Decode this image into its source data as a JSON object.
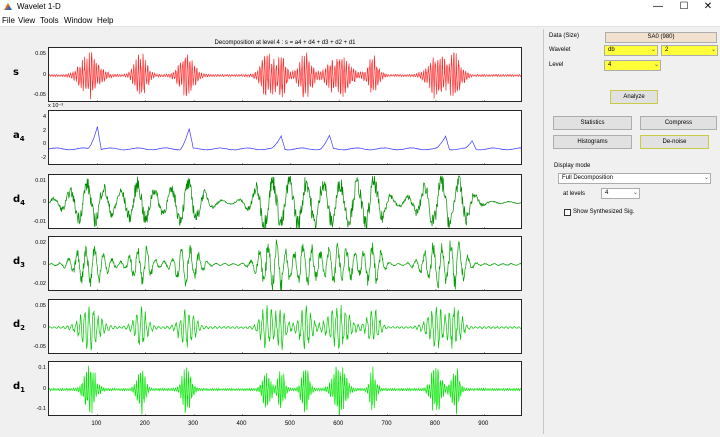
{
  "window": {
    "title": "Wavelet 1-D",
    "minimize": "—",
    "maximize": "☐",
    "close": "✕"
  },
  "menu": [
    "File",
    "View",
    "Tools",
    "Window",
    "Help"
  ],
  "figure": {
    "title": "Decomposition at level 4 : s = a4 + d4 + d3 + d2 + d1",
    "rows": [
      {
        "label": "s",
        "sub": "",
        "ticks": [
          "0.05",
          "0",
          "-0.05"
        ],
        "exponent": "",
        "color": "#ff2a2a"
      },
      {
        "label": "a",
        "sub": "4",
        "ticks": [
          "4",
          "2",
          "0",
          "-2"
        ],
        "exponent": "x 10⁻³",
        "color": "#3a3aff"
      },
      {
        "label": "d",
        "sub": "4",
        "ticks": [
          "0.01",
          "0",
          "-0.01"
        ],
        "exponent": "",
        "color": "#008c00"
      },
      {
        "label": "d",
        "sub": "3",
        "ticks": [
          "0.02",
          "0",
          "-0.02"
        ],
        "exponent": "",
        "color": "#00a000"
      },
      {
        "label": "d",
        "sub": "2",
        "ticks": [
          "0.05",
          "0",
          "-0.05"
        ],
        "exponent": "",
        "color": "#00c800"
      },
      {
        "label": "d",
        "sub": "1",
        "ticks": [
          "0.1",
          "0",
          "-0.1"
        ],
        "exponent": "",
        "color": "#00e600"
      }
    ],
    "xticks": [
      "100",
      "200",
      "300",
      "400",
      "500",
      "600",
      "700",
      "800",
      "900"
    ],
    "xlim": [
      0,
      980
    ]
  },
  "panel": {
    "data_label": "Data  (Size)",
    "data_value": "SA0  (980)",
    "wavelet_label": "Wavelet",
    "wavelet_family": "db",
    "wavelet_order": "2",
    "level_label": "Level",
    "level_value": "4",
    "analyze": "Analyze",
    "statistics": "Statistics",
    "compress": "Compress",
    "histograms": "Histograms",
    "denoise": "De-noise",
    "display_mode_label": "Display mode",
    "display_mode_value": "Full Decomposition",
    "at_levels_label": "at levels",
    "at_levels_value": "4",
    "show_synth": "Show Synthesized Sig.",
    "highlight_color": "#ffff3a"
  }
}
